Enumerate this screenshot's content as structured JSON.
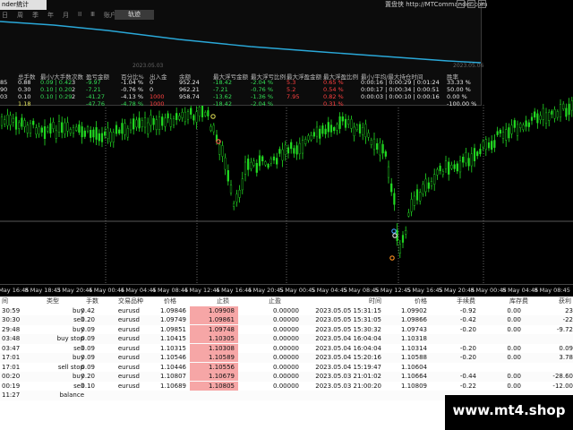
{
  "stats_window": {
    "title_fragment": "nder统计",
    "menu": [
      "日",
      "周",
      "季",
      "年",
      "月",
      "II",
      "Ⅲ",
      "账户"
    ],
    "active_tab": "轨迹",
    "brand": "置盘侠 http://MTCommander.com",
    "curve_date_start": "2023.05.03",
    "curve_date_end": "2023.05.06",
    "headers": [
      "总手数",
      "最小/大手数",
      "次数",
      "盈亏金额",
      "百分比%",
      "出入金",
      "余额",
      "最大浮亏金额",
      "最大浮亏比例",
      "最大浮盈金额",
      "最大浮盈比例",
      "最小/平均/最大持仓时间",
      "胜率"
    ],
    "rows": [
      {
        "prefix": "85",
        "total": "0.88",
        "minmax": "0.09 | 0.42",
        "count": "3",
        "pnl": "-9.97",
        "pct": "-1.04 %",
        "deposit": "0",
        "balance": "952.24",
        "max_float_loss": "-18.42",
        "max_float_loss_pct": "-2.04 %",
        "max_float_profit": "5.3",
        "max_float_profit_pct": "0.65 %",
        "hold_time": "0:00:16 | 0:00:29 | 0:01:24",
        "win_rate": "33.33 %"
      },
      {
        "prefix": "90",
        "total": "0.30",
        "minmax": "0.10 | 0.20",
        "count": "2",
        "pnl": "-7.21",
        "pct": "-0.76 %",
        "deposit": "0",
        "balance": "962.21",
        "max_float_loss": "-7.21",
        "max_float_loss_pct": "-0.76 %",
        "max_float_profit": "5.2",
        "max_float_profit_pct": "0.54 %",
        "hold_time": "0:00:17 | 0:00:34 | 0:00:51",
        "win_rate": "50.00 %"
      },
      {
        "prefix": "03",
        "total": "0.10",
        "minmax": "0.10 | 0:29",
        "count": "2",
        "pnl": "-41.27",
        "pct": "-4.13 %",
        "deposit": "1000",
        "balance": "958.74",
        "max_float_loss": "-13.62",
        "max_float_loss_pct": "-1.36 %",
        "max_float_profit": "7.95",
        "max_float_profit_pct": "0.82 %",
        "hold_time": "0:00:03 | 0:00:10 | 0:00:16",
        "win_rate": "0.00 %"
      },
      {
        "prefix": "",
        "total": "1.18",
        "minmax": "",
        "count": "",
        "pnl": "-47.76",
        "pct": "-4.78 %",
        "deposit": "1000",
        "balance": "",
        "max_float_loss": "-18.42",
        "max_float_loss_pct": "-2.04 %",
        "max_float_profit": "",
        "max_float_profit_pct": "0.31 %",
        "hold_time": "",
        "win_rate": "-100.00 %"
      }
    ]
  },
  "time_axis": [
    "8 May 16:45",
    "8 May 18:45",
    "3 May 20:45",
    "4 May 00:45",
    "4 May 04:45",
    "4 May 08:45",
    "4 May 12:45",
    "4 May 16:45",
    "4 May 20:45",
    "5 May 00:45",
    "5 May 04:45",
    "5 May 08:45",
    "5 May 12:45",
    "5 May 16:45",
    "5 May 20:45",
    "8 May 00:45",
    "8 May 04:45",
    "8 May 08:45"
  ],
  "trades": {
    "headers": [
      "间",
      "类型",
      "手数",
      "交易品种",
      "价格",
      "止损",
      "止盈",
      "时间",
      "价格",
      "手续费",
      "库存费",
      "获利"
    ],
    "rows": [
      {
        "open_time": "30:59",
        "type": "buy",
        "lots": "0.42",
        "symbol": "eurusd",
        "price": "1.09846",
        "sl": "1.09908",
        "tp": "0.00000",
        "close_time": "2023.05.05 15:31:15",
        "close_price": "1.09902",
        "commission": "-0.92",
        "swap": "0.00",
        "profit": "23"
      },
      {
        "open_time": "30:30",
        "type": "sell",
        "lots": "0.20",
        "symbol": "eurusd",
        "price": "1.09749",
        "sl": "1.09861",
        "tp": "0.00000",
        "close_time": "2023.05.05 15:31:05",
        "close_price": "1.09866",
        "commission": "-0.42",
        "swap": "0.00",
        "profit": "-22"
      },
      {
        "open_time": "29:48",
        "type": "buy",
        "lots": "0.09",
        "symbol": "eurusd",
        "price": "1.09851",
        "sl": "1.09748",
        "tp": "0.00000",
        "close_time": "2023.05.05 15:30:32",
        "close_price": "1.09743",
        "commission": "-0.20",
        "swap": "0.00",
        "profit": "-9.72"
      },
      {
        "open_time": "03:48",
        "type": "buy stop",
        "lots": "0.09",
        "symbol": "eurusd",
        "price": "1.10415",
        "sl": "1.10305",
        "tp": "0.00000",
        "close_time": "2023.05.04 16:04:04",
        "close_price": "1.10318",
        "commission": "",
        "swap": "",
        "profit": ""
      },
      {
        "open_time": "03:47",
        "type": "sell",
        "lots": "0.09",
        "symbol": "eurusd",
        "price": "1.10315",
        "sl": "1.10308",
        "tp": "0.00000",
        "close_time": "2023.05.04 16:04:04",
        "close_price": "1.10314",
        "commission": "-0.20",
        "swap": "0.00",
        "profit": "0.09"
      },
      {
        "open_time": "17:01",
        "type": "buy",
        "lots": "0.09",
        "symbol": "eurusd",
        "price": "1.10546",
        "sl": "1.10589",
        "tp": "0.00000",
        "close_time": "2023.05.04 15:20:16",
        "close_price": "1.10588",
        "commission": "-0.20",
        "swap": "0.00",
        "profit": "3.78"
      },
      {
        "open_time": "17:01",
        "type": "sell stop",
        "lots": "0.09",
        "symbol": "eurusd",
        "price": "1.10446",
        "sl": "1.10556",
        "tp": "0.00000",
        "close_time": "2023.05.04 15:19:47",
        "close_price": "1.10604",
        "commission": "",
        "swap": "",
        "profit": ""
      },
      {
        "open_time": "00:20",
        "type": "buy",
        "lots": "0.20",
        "symbol": "eurusd",
        "price": "1.10807",
        "sl": "1.10679",
        "tp": "0.00000",
        "close_time": "2023.05.03 21:01:02",
        "close_price": "1.10664",
        "commission": "-0.44",
        "swap": "0.00",
        "profit": "-28.60"
      },
      {
        "open_time": "00:19",
        "type": "sell",
        "lots": "0.10",
        "symbol": "eurusd",
        "price": "1.10689",
        "sl": "1.10805",
        "tp": "0.00000",
        "close_time": "2023.05.03 21:00:20",
        "close_price": "1.10809",
        "commission": "-0.22",
        "swap": "0.00",
        "profit": "-12.00"
      },
      {
        "open_time": "11:27",
        "type": "balance",
        "lots": "",
        "symbol": "",
        "price": "",
        "sl": "",
        "tp": "",
        "close_time": "",
        "close_price": "",
        "commission": "",
        "swap": "",
        "profit": ""
      }
    ]
  },
  "watermark": "www.mt4.shop",
  "colors": {
    "candle": "#22dd22",
    "equity_curve": "#2aa8d8",
    "sl_highlight": "#f6a6a6",
    "positive": "#33dd55",
    "negative": "#ff4040"
  }
}
